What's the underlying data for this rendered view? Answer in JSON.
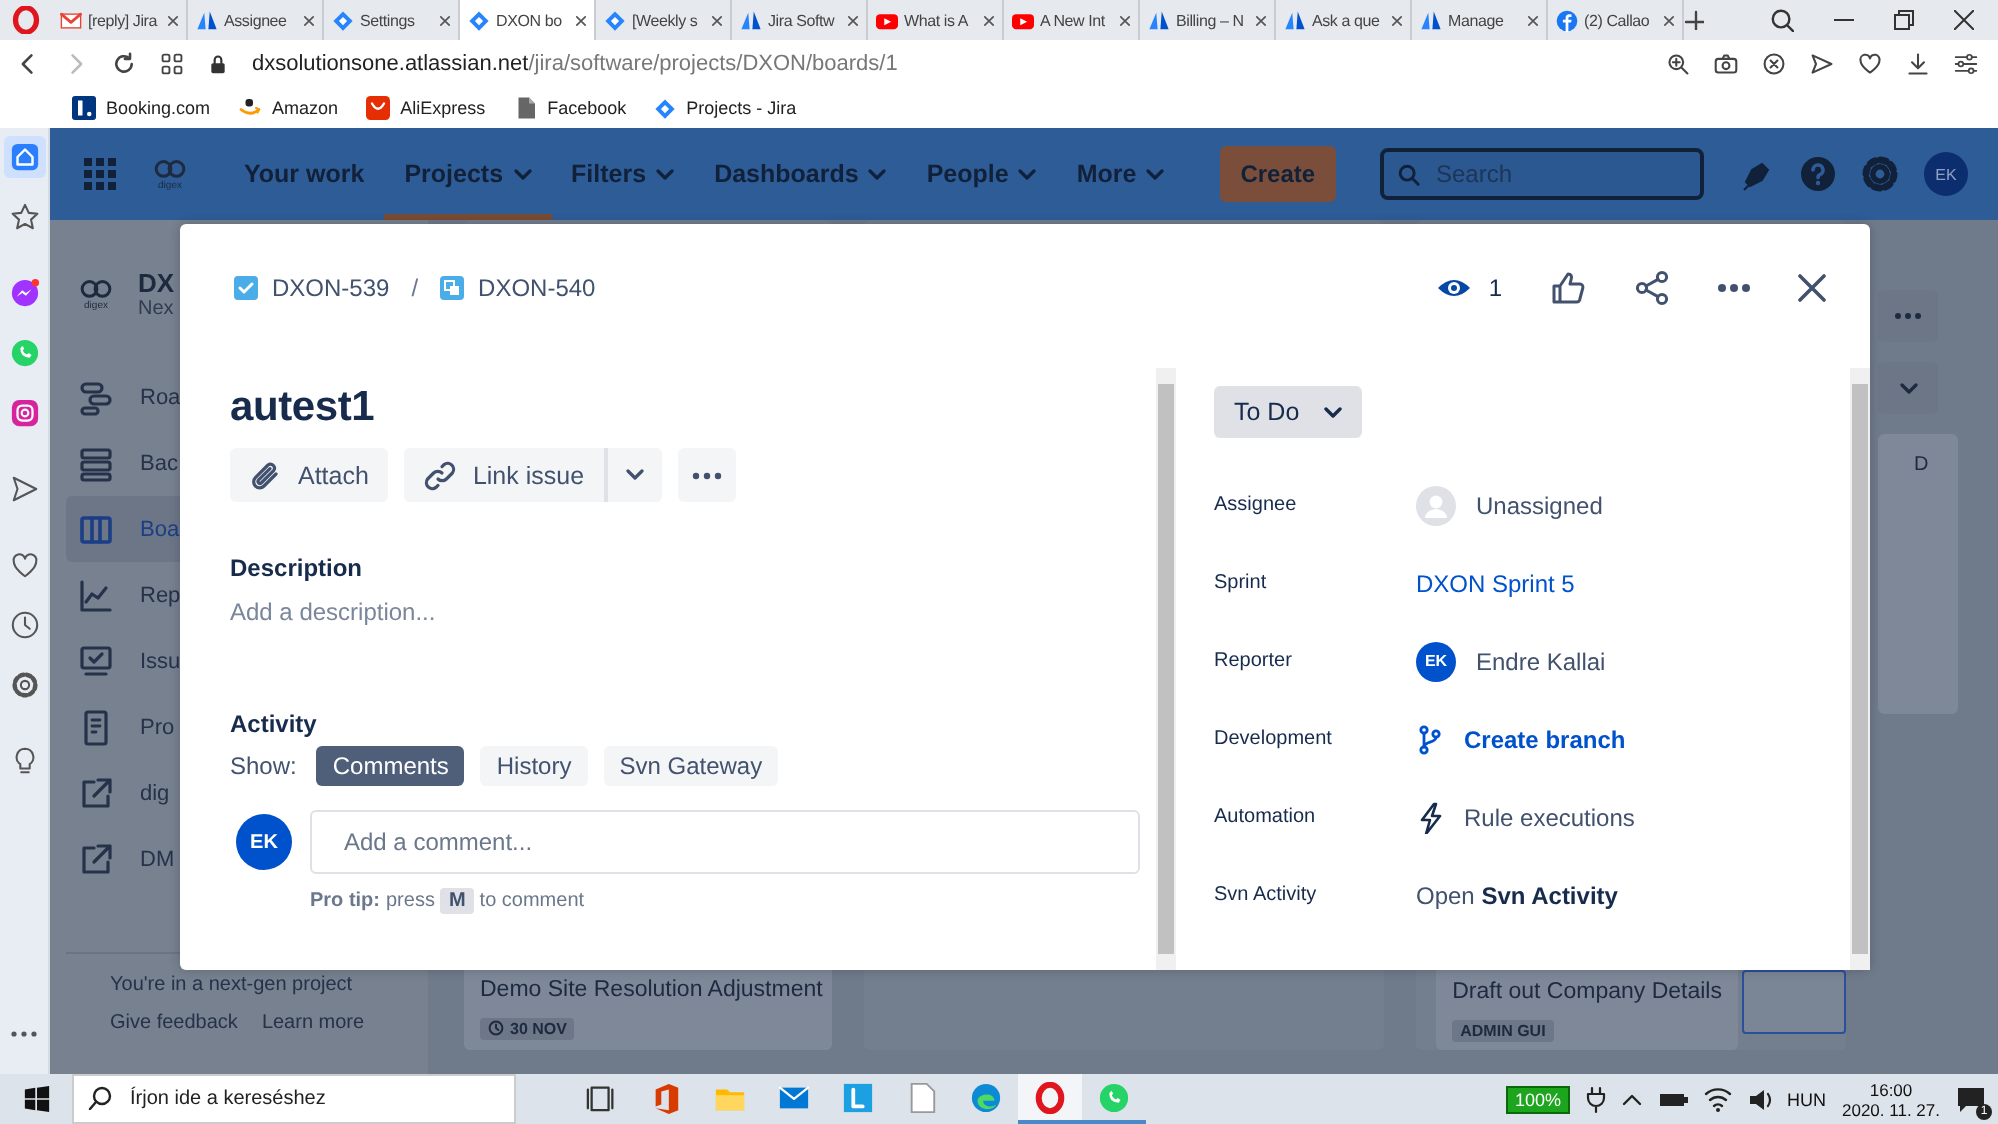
{
  "browser": {
    "tabs": [
      {
        "title": "[reply] Jira",
        "kind": "gmail",
        "selected": false
      },
      {
        "title": "Assignee",
        "kind": "atlassian",
        "selected": false
      },
      {
        "title": "Settings",
        "kind": "jira",
        "selected": false
      },
      {
        "title": "DXON bo",
        "kind": "jira",
        "selected": true
      },
      {
        "title": "[Weekly s",
        "kind": "jira",
        "selected": false
      },
      {
        "title": "Jira Softw",
        "kind": "atlassian",
        "selected": false
      },
      {
        "title": "What is A",
        "kind": "youtube",
        "selected": false
      },
      {
        "title": "A New Int",
        "kind": "youtube",
        "selected": false
      },
      {
        "title": "Billing – N",
        "kind": "atlassian",
        "selected": false
      },
      {
        "title": "Ask a que",
        "kind": "atlassian",
        "selected": false
      },
      {
        "title": "Manage",
        "kind": "atlassian",
        "selected": false
      },
      {
        "title": "(2) Callao",
        "kind": "facebook",
        "selected": false
      }
    ],
    "address": {
      "host": "dxsolutionsone.atlassian.net",
      "path": "/jira/software/projects/DXON/boards/1"
    },
    "bookmarks": [
      {
        "label": "Booking.com",
        "kind": "booking"
      },
      {
        "label": "Amazon",
        "kind": "amazon"
      },
      {
        "label": "AliExpress",
        "kind": "aliexpress"
      },
      {
        "label": "Facebook",
        "kind": "page"
      },
      {
        "label": "Projects - Jira",
        "kind": "jira"
      }
    ]
  },
  "opera_sidebar": {
    "items": [
      {
        "kind": "home",
        "selected": true
      },
      {
        "kind": "star",
        "selected": false
      },
      {
        "kind": "messenger",
        "selected": false
      },
      {
        "kind": "whatsapp",
        "selected": false
      },
      {
        "kind": "instagram",
        "selected": false
      },
      {
        "kind": "send",
        "selected": false
      },
      {
        "kind": "heart",
        "selected": false
      },
      {
        "kind": "clock",
        "selected": false
      },
      {
        "kind": "gear",
        "selected": false
      },
      {
        "kind": "bulb",
        "selected": false
      }
    ]
  },
  "jira_nav": {
    "logo_text": "digex",
    "items": [
      {
        "label": "Your work",
        "dropdown": false,
        "selected": false
      },
      {
        "label": "Projects",
        "dropdown": true,
        "selected": true
      },
      {
        "label": "Filters",
        "dropdown": true,
        "selected": false
      },
      {
        "label": "Dashboards",
        "dropdown": true,
        "selected": false
      },
      {
        "label": "People",
        "dropdown": true,
        "selected": false
      },
      {
        "label": "More",
        "dropdown": true,
        "selected": false
      }
    ],
    "create": "Create",
    "search": {
      "placeholder": "Search"
    },
    "avatar": "EK"
  },
  "project_sidebar": {
    "logo_text": "digex",
    "name": "DX",
    "subtitle": "Nex",
    "items": [
      {
        "label": "Roa",
        "kind": "roadmap",
        "selected": false
      },
      {
        "label": "Bac",
        "kind": "backlog",
        "selected": false
      },
      {
        "label": "Boa",
        "kind": "board",
        "selected": true
      },
      {
        "label": "Rep",
        "kind": "reports",
        "selected": false
      },
      {
        "label": "Issu",
        "kind": "issues",
        "selected": false
      },
      {
        "label": "Pro",
        "kind": "page",
        "selected": false
      },
      {
        "label": "dig",
        "kind": "external",
        "selected": false
      },
      {
        "label": "DM",
        "kind": "external",
        "selected": false
      }
    ],
    "footer": "You're in a next-gen project",
    "links": [
      "Give feedback",
      "Learn more"
    ]
  },
  "board": {
    "cards": [
      {
        "title": "Demo Site Resolution Adjustment",
        "tag": "30 NOV",
        "kind": "date"
      },
      {
        "title": "Draft out Company Details",
        "tag": "ADMIN GUI",
        "kind": "label"
      }
    ],
    "right_card": "D"
  },
  "modal": {
    "breadcrumbs": [
      {
        "key": "DXON-539",
        "kind": "story"
      },
      {
        "key": "DXON-540",
        "kind": "subtask"
      }
    ],
    "separator": "/",
    "watchers": "1",
    "title": "autest1",
    "actions": [
      "Attach",
      "Link issue"
    ],
    "description": {
      "label": "Description",
      "placeholder": "Add a description..."
    },
    "activity": {
      "label": "Activity",
      "show": "Show:",
      "filters": [
        {
          "label": "Comments",
          "selected": true
        },
        {
          "label": "History",
          "selected": false
        },
        {
          "label": "Svn Gateway",
          "selected": false
        }
      ],
      "avatar": "EK",
      "comment_placeholder": "Add a comment...",
      "tip_lead": "Pro tip:",
      "tip_press": "press",
      "tip_key": "M",
      "tip_tail": "to comment"
    },
    "status": "To Do",
    "fields": [
      {
        "label": "Assignee",
        "kind": "empty_user",
        "value": "Unassigned"
      },
      {
        "label": "Sprint",
        "kind": "link",
        "value": "DXON Sprint 5"
      },
      {
        "label": "Reporter",
        "kind": "user",
        "value": "Endre Kallai",
        "avatar": "EK"
      },
      {
        "label": "Development",
        "kind": "branch",
        "value": "Create branch"
      },
      {
        "label": "Automation",
        "kind": "automation",
        "value": "Rule executions"
      },
      {
        "label": "Svn Activity",
        "kind": "plain",
        "value": "Open **Svn Activity**"
      }
    ]
  },
  "taskbar": {
    "search": {
      "placeholder": "Írjon ide a kereséshez"
    },
    "apps": [
      {
        "kind": "taskview",
        "selected": false,
        "running": false
      },
      {
        "kind": "office",
        "selected": false,
        "running": false
      },
      {
        "kind": "explorer",
        "selected": false,
        "running": false
      },
      {
        "kind": "mail",
        "selected": false,
        "running": false
      },
      {
        "kind": "lapp",
        "selected": false,
        "running": false
      },
      {
        "kind": "file",
        "selected": false,
        "running": false
      },
      {
        "kind": "edge",
        "selected": false,
        "running": false
      },
      {
        "kind": "opera",
        "selected": true,
        "running": true
      },
      {
        "kind": "whatsapp",
        "selected": false,
        "running": true
      }
    ],
    "battery": "100%",
    "language": "HUN",
    "time": "16:00",
    "date": "2020. 11. 27.",
    "notifications": "1"
  }
}
